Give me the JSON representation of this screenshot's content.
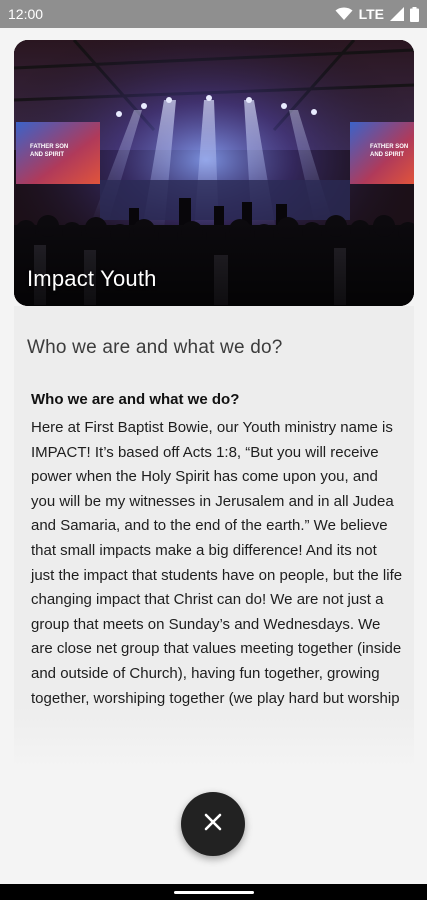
{
  "status_bar": {
    "time": "12:00",
    "network": "LTE",
    "icons": [
      "wifi-icon",
      "signal-icon",
      "battery-icon"
    ]
  },
  "card": {
    "title": "Impact Youth",
    "image_description": "church-stage-worship-image"
  },
  "content": {
    "subtitle": "Who we are and what we do?",
    "heading": "Who we are and what we do?",
    "body": "Here at First Baptist Bowie, our Youth ministry name is IMPACT! It’s based off Acts 1:8, “But you will receive power when the Holy Spirit has come upon you, and you will be my witnesses in Jerusalem and in all Judea and Samaria, and to the end of the earth.” We believe that small impacts make a big difference! And its not just the impact that students have on people, but the life changing impact that Christ can do! We are not just a group that meets on Sunday’s and Wednesdays. We are close net group that values meeting together (inside and outside of Church), having fun together, growing together, worshiping together (we play hard but worship"
  },
  "fab": {
    "icon": "close-icon"
  },
  "colors": {
    "status_bar": "#8f8f8f",
    "background": "#f4f4f4",
    "content_bg": "#ededed",
    "fab": "#222222"
  }
}
